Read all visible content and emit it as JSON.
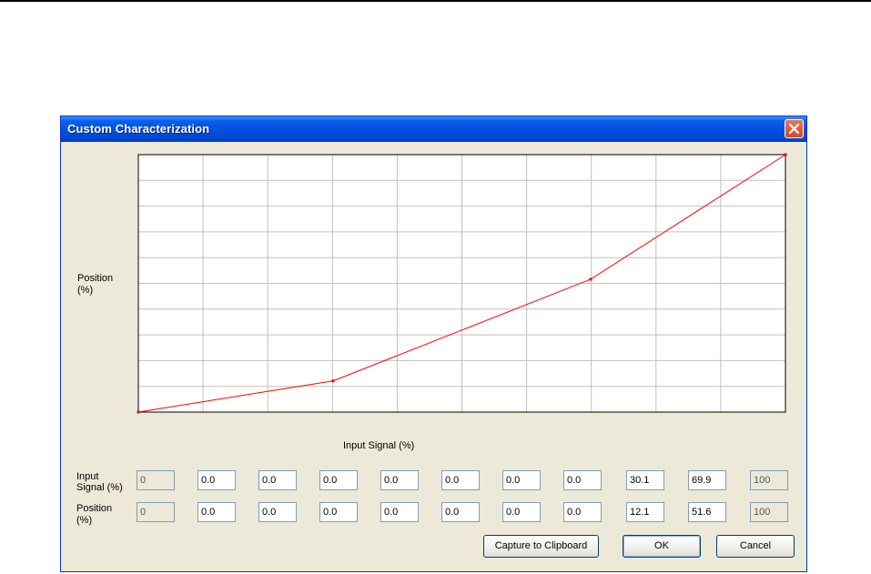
{
  "window": {
    "title": "Custom Characterization",
    "close_icon": "close-icon"
  },
  "chart_data": {
    "type": "line",
    "xlabel": "Input Signal (%)",
    "ylabel_line1": "Position",
    "ylabel_line2": "(%)",
    "xlim": [
      0,
      100
    ],
    "ylim": [
      0,
      100
    ],
    "grid": true,
    "series": [
      {
        "x": [
          0,
          0.0,
          0.0,
          0.0,
          0.0,
          0.0,
          0.0,
          0.0,
          30.1,
          69.9,
          100
        ],
        "y": [
          0,
          0.0,
          0.0,
          0.0,
          0.0,
          0.0,
          0.0,
          0.0,
          12.1,
          51.6,
          100
        ],
        "color": "#ff0000"
      }
    ]
  },
  "table": {
    "input_label_line1": "Input",
    "input_label_line2": "Signal (%)",
    "position_label_line1": "Position",
    "position_label_line2": "(%)",
    "input_values": [
      "0",
      "0.0",
      "0.0",
      "0.0",
      "0.0",
      "0.0",
      "0.0",
      "0.0",
      "30.1",
      "69.9",
      "100"
    ],
    "position_values": [
      "0",
      "0.0",
      "0.0",
      "0.0",
      "0.0",
      "0.0",
      "0.0",
      "0.0",
      "12.1",
      "51.6",
      "100"
    ]
  },
  "buttons": {
    "capture_label": "Capture to Clipboard",
    "ok_label": "OK",
    "cancel_label": "Cancel"
  },
  "colors": {
    "title_bar": "#0054e3",
    "dialog_face": "#ece9d8",
    "curve": "#ff0000",
    "grid": "#c0c0c0"
  }
}
